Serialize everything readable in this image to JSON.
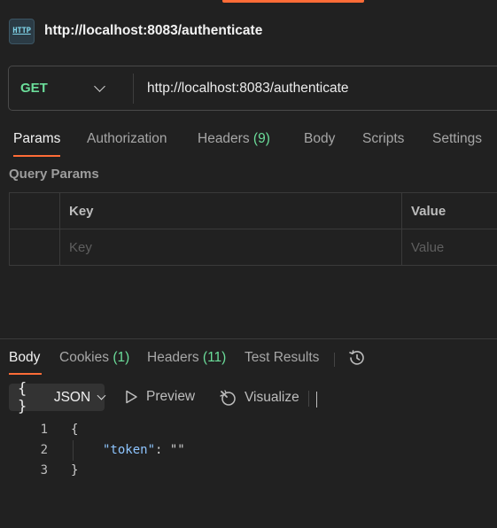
{
  "request": {
    "icon_text": "HTTP",
    "title": "http://localhost:8083/authenticate",
    "method": "GET",
    "url": "http://localhost:8083/authenticate"
  },
  "request_tabs": {
    "params": "Params",
    "authorization": "Authorization",
    "headers": "Headers",
    "headers_count": "(9)",
    "body": "Body",
    "scripts": "Scripts",
    "settings": "Settings"
  },
  "query_params": {
    "title": "Query Params",
    "columns": {
      "key": "Key",
      "value": "Value"
    },
    "key_placeholder": "Key",
    "value_placeholder": "Value"
  },
  "response_tabs": {
    "body": "Body",
    "cookies": "Cookies",
    "cookies_count": "(1)",
    "headers": "Headers",
    "headers_count": "(11)",
    "test_results": "Test Results"
  },
  "response_toolbar": {
    "format_icon": "{ }",
    "format": "JSON",
    "preview": "Preview",
    "visualize": "Visualize"
  },
  "response_body": {
    "line_numbers": [
      "1",
      "2",
      "3"
    ],
    "open_brace": "{",
    "key": "\"token\"",
    "colon": ": ",
    "value": "\"\"",
    "close_brace": "}"
  },
  "colors": {
    "accent": "#ff6c37",
    "method_get": "#6bdd9a",
    "count": "#6bdd9a",
    "json_key": "#8ec5ff",
    "background": "#212121"
  },
  "icons": [
    "http-icon",
    "chevron-down-icon",
    "history-icon",
    "play-icon",
    "visualize-icon"
  ]
}
